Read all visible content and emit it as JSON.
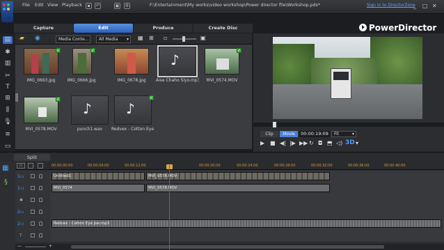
{
  "window": {
    "menu": [
      "File",
      "Edit",
      "View",
      "Playback"
    ],
    "file_path": "F:\\Entertainment\\My works\\video workshop\\Power director file\\Workshop.pds*",
    "signin": "Sign in to DirectorZone",
    "brand": "PowerDirector"
  },
  "tabs": [
    "Capture",
    "Edit",
    "Produce",
    "Create Disc"
  ],
  "active_tab": "Edit",
  "library": {
    "filter_left": "Media Conte...",
    "filter_right": "All Media",
    "items": [
      {
        "label": "IMG_0663.jpg"
      },
      {
        "label": "IMG_0666.jpg"
      },
      {
        "label": "IMG_0678.jpg"
      },
      {
        "label": "Aise Chaho Siyo.mp3"
      },
      {
        "label": "MVI_0574.MOV"
      },
      {
        "label": "MVI_0578.MOV"
      },
      {
        "label": "punch1.wav"
      },
      {
        "label": "Redvex - Cotton Eye..."
      }
    ]
  },
  "preview": {
    "mode_clip": "Clip",
    "mode_movie": "Movie",
    "timecode": "00:00:19:09",
    "fit": "Fit",
    "colors": {
      "accent": "#4a7fd6",
      "playhead": "#d9342a"
    }
  },
  "timeline": {
    "split_label": "Split",
    "ruler": [
      "00:00:00:00",
      "00:00:04:00",
      "00:00:08:00",
      "00:00:12:00",
      "00:00:16:00",
      "00:00:20:00",
      "00:00:24:00",
      "00:00:28:00",
      "00:00:32:00",
      "00:00:36:00",
      "00:00:40:00",
      "00:00:44:00"
    ],
    "clips": {
      "v1a": "Untitled1",
      "v1b": "MVI_0578.MOV",
      "a1a": "MVI_0574",
      "a1b": "MVI_0578.MOV",
      "music": "Redvex - Cotton Eye Joe.mp3"
    }
  }
}
